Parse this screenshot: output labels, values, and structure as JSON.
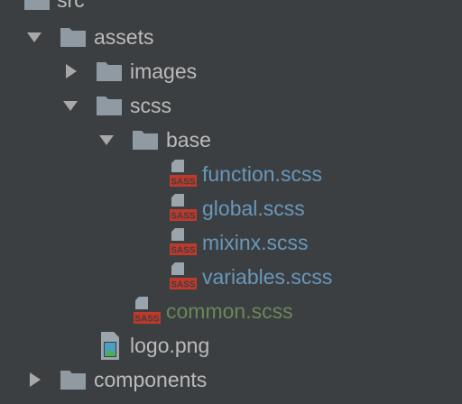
{
  "tree": {
    "items": [
      {
        "label": "src",
        "type": "folder",
        "expanded": true
      },
      {
        "label": "assets",
        "type": "folder",
        "expanded": true
      },
      {
        "label": "images",
        "type": "folder",
        "expanded": false
      },
      {
        "label": "scss",
        "type": "folder",
        "expanded": true
      },
      {
        "label": "base",
        "type": "folder",
        "expanded": true
      },
      {
        "label": "function.scss",
        "type": "sass-file"
      },
      {
        "label": "global.scss",
        "type": "sass-file"
      },
      {
        "label": "mixinx.scss",
        "type": "sass-file"
      },
      {
        "label": "variables.scss",
        "type": "sass-file"
      },
      {
        "label": "common.scss",
        "type": "sass-file"
      },
      {
        "label": "logo.png",
        "type": "image-file"
      },
      {
        "label": "components",
        "type": "folder",
        "expanded": false
      }
    ],
    "sass_badge": "SASS"
  },
  "colors": {
    "background": "#3c3f41",
    "text": "#bbbbbb",
    "sass_file_text": "#6897bb",
    "modified_file_text": "#6a8759",
    "folder_icon": "#8f9aa3",
    "sass_badge": "#c0392b"
  },
  "icons": {
    "folder": "folder-icon",
    "sass_file": "sass-file-icon",
    "image_file": "image-file-icon",
    "expanded": "chevron-down-icon",
    "collapsed": "chevron-right-icon"
  }
}
